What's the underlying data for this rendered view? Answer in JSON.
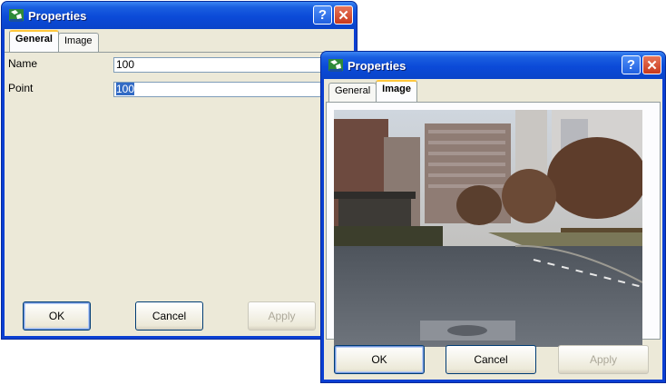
{
  "back_window": {
    "title": "Properties",
    "tabs": [
      {
        "label": "General",
        "active": true
      },
      {
        "label": "Image",
        "active": false
      }
    ],
    "fields": [
      {
        "label": "Name",
        "value": "100",
        "selected": false
      },
      {
        "label": "Point",
        "value": "100",
        "selected": true
      }
    ],
    "buttons": {
      "ok": "OK",
      "cancel": "Cancel",
      "apply": "Apply"
    }
  },
  "front_window": {
    "title": "Properties",
    "tabs": [
      {
        "label": "General",
        "active": false
      },
      {
        "label": "Image",
        "active": true
      }
    ],
    "image_alt": "street photograph",
    "buttons": {
      "ok": "OK",
      "cancel": "Cancel",
      "apply": "Apply"
    }
  },
  "colors": {
    "titlebar_blue": "#0a44c9",
    "dialog_face": "#ece9d8",
    "close_red": "#c8391c",
    "selection": "#316ac5"
  }
}
